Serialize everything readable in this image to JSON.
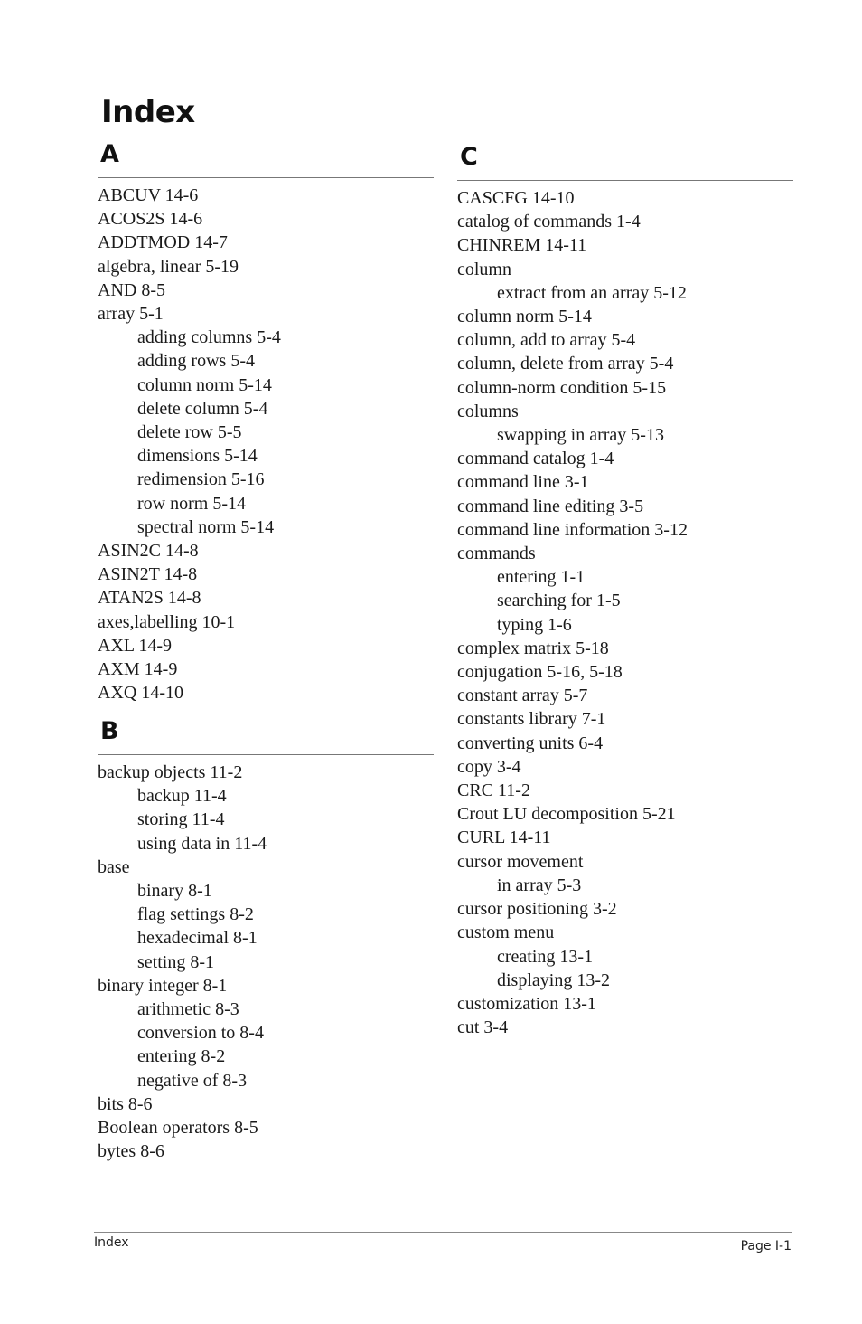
{
  "page": {
    "title": "Index",
    "footer_left": "Index",
    "footer_right": "Page I-1"
  },
  "sections": {
    "A": {
      "letter": "A",
      "entries": [
        {
          "text": "ABCUV 14-6",
          "level": 0
        },
        {
          "text": "ACOS2S 14-6",
          "level": 0
        },
        {
          "text": "ADDTMOD 14-7",
          "level": 0
        },
        {
          "text": "algebra, linear 5-19",
          "level": 0
        },
        {
          "text": "AND 8-5",
          "level": 0
        },
        {
          "text": "array 5-1",
          "level": 0
        },
        {
          "text": "adding columns 5-4",
          "level": 1
        },
        {
          "text": "adding rows 5-4",
          "level": 1
        },
        {
          "text": "column norm 5-14",
          "level": 1
        },
        {
          "text": "delete column 5-4",
          "level": 1
        },
        {
          "text": "delete row 5-5",
          "level": 1
        },
        {
          "text": "dimensions 5-14",
          "level": 1
        },
        {
          "text": "redimension 5-16",
          "level": 1
        },
        {
          "text": "row norm 5-14",
          "level": 1
        },
        {
          "text": "spectral norm 5-14",
          "level": 1
        },
        {
          "text": "ASIN2C 14-8",
          "level": 0
        },
        {
          "text": "ASIN2T 14-8",
          "level": 0
        },
        {
          "text": "ATAN2S 14-8",
          "level": 0
        },
        {
          "text": "axes,labelling 10-1",
          "level": 0
        },
        {
          "text": "AXL 14-9",
          "level": 0
        },
        {
          "text": "AXM 14-9",
          "level": 0
        },
        {
          "text": "AXQ 14-10",
          "level": 0
        }
      ]
    },
    "B": {
      "letter": "B",
      "entries": [
        {
          "text": "backup objects 11-2",
          "level": 0
        },
        {
          "text": "backup 11-4",
          "level": 1
        },
        {
          "text": "storing 11-4",
          "level": 1
        },
        {
          "text": "using data in 11-4",
          "level": 1
        },
        {
          "text": "base",
          "level": 0
        },
        {
          "text": "binary 8-1",
          "level": 1
        },
        {
          "text": "flag settings 8-2",
          "level": 1
        },
        {
          "text": "hexadecimal 8-1",
          "level": 1
        },
        {
          "text": "setting 8-1",
          "level": 1
        },
        {
          "text": "binary integer 8-1",
          "level": 0
        },
        {
          "text": "arithmetic 8-3",
          "level": 1
        },
        {
          "text": "conversion to 8-4",
          "level": 1
        },
        {
          "text": "entering 8-2",
          "level": 1
        },
        {
          "text": "negative of 8-3",
          "level": 1
        },
        {
          "text": "bits 8-6",
          "level": 0
        },
        {
          "text": "Boolean operators 8-5",
          "level": 0
        },
        {
          "text": "bytes 8-6",
          "level": 0
        }
      ]
    },
    "C": {
      "letter": "C",
      "entries": [
        {
          "text": "CASCFG 14-10",
          "level": 0
        },
        {
          "text": "catalog of commands 1-4",
          "level": 0
        },
        {
          "text": "CHINREM 14-11",
          "level": 0
        },
        {
          "text": "column",
          "level": 0
        },
        {
          "text": "extract from an array 5-12",
          "level": 1
        },
        {
          "text": "column norm 5-14",
          "level": 0
        },
        {
          "text": "column, add to array 5-4",
          "level": 0
        },
        {
          "text": "column, delete from array 5-4",
          "level": 0
        },
        {
          "text": "column-norm condition 5-15",
          "level": 0
        },
        {
          "text": "columns",
          "level": 0
        },
        {
          "text": "swapping in array 5-13",
          "level": 1
        },
        {
          "text": "command catalog 1-4",
          "level": 0
        },
        {
          "text": "command line 3-1",
          "level": 0
        },
        {
          "text": "command line editing 3-5",
          "level": 0
        },
        {
          "text": "command line information 3-12",
          "level": 0
        },
        {
          "text": "commands",
          "level": 0
        },
        {
          "text": "entering 1-1",
          "level": 1
        },
        {
          "text": "searching for 1-5",
          "level": 1
        },
        {
          "text": "typing 1-6",
          "level": 1
        },
        {
          "text": "complex matrix 5-18",
          "level": 0
        },
        {
          "text": "conjugation 5-16, 5-18",
          "level": 0
        },
        {
          "text": "constant array 5-7",
          "level": 0
        },
        {
          "text": "constants library 7-1",
          "level": 0
        },
        {
          "text": "converting units 6-4",
          "level": 0
        },
        {
          "text": "copy 3-4",
          "level": 0
        },
        {
          "text": "CRC 11-2",
          "level": 0
        },
        {
          "text": "Crout LU decomposition 5-21",
          "level": 0
        },
        {
          "text": "CURL 14-11",
          "level": 0
        },
        {
          "text": "cursor movement",
          "level": 0
        },
        {
          "text": "in array 5-3",
          "level": 1
        },
        {
          "text": "cursor positioning 3-2",
          "level": 0
        },
        {
          "text": "custom menu",
          "level": 0
        },
        {
          "text": "creating 13-1",
          "level": 1
        },
        {
          "text": "displaying 13-2",
          "level": 1
        },
        {
          "text": "customization 13-1",
          "level": 0
        },
        {
          "text": "cut 3-4",
          "level": 0
        }
      ]
    }
  }
}
